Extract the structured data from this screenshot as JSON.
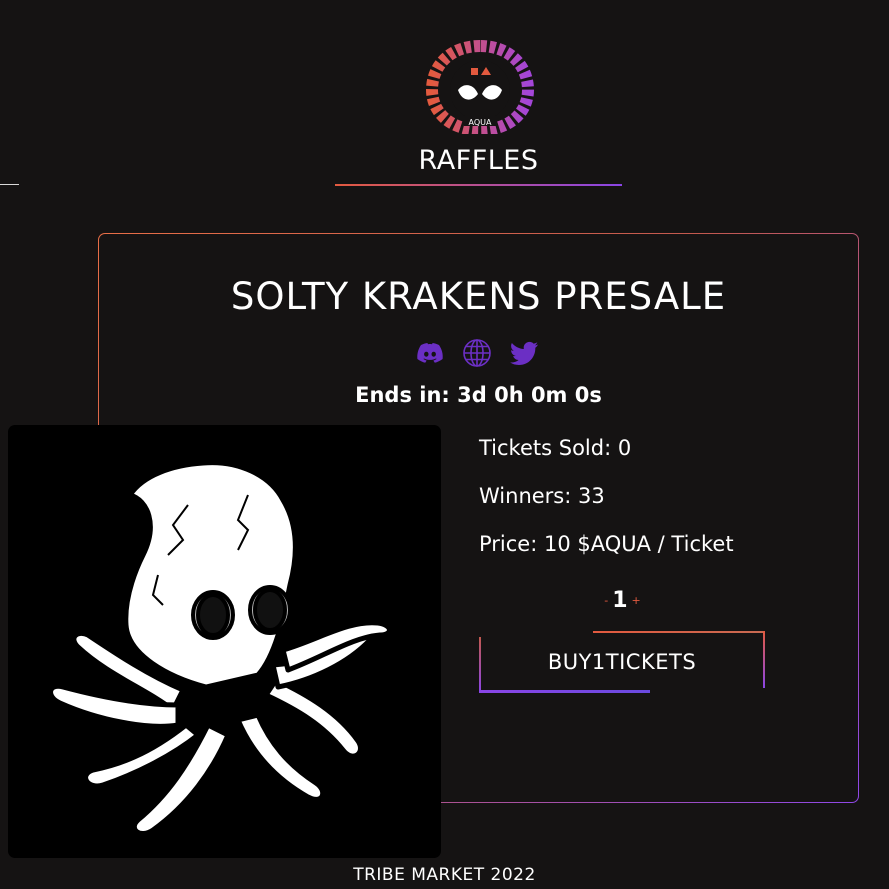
{
  "header": {
    "logo_text": "AQUA",
    "title": "RAFFLES"
  },
  "raffle": {
    "title": "SOLTY KRAKENS PRESALE",
    "socials": [
      {
        "icon": "discord-icon"
      },
      {
        "icon": "globe-icon"
      },
      {
        "icon": "twitter-icon"
      }
    ],
    "ends_in": "Ends in: 3d 0h 0m 0s",
    "tickets_sold": "Tickets Sold: 0",
    "winners": "Winners: 33",
    "price": "Price: 10 $AQUA / Ticket",
    "quantity": {
      "minus": "-",
      "value": "1",
      "plus": "+"
    },
    "buy_label": "BUY1TICKETS"
  },
  "footer": {
    "text": "TRIBE MARKET 2022"
  },
  "colors": {
    "background": "#151313",
    "accent_orange": "#e35a3f",
    "accent_purple": "#8a45e6",
    "icon_purple": "#6b2fc4"
  }
}
